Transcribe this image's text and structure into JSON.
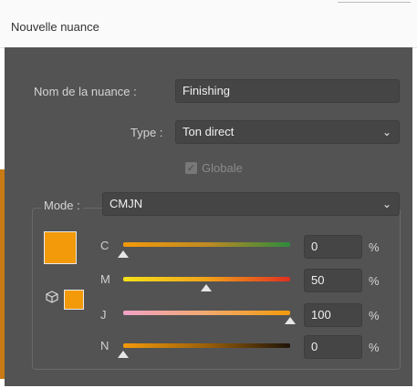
{
  "dialog": {
    "title": "Nouvelle nuance"
  },
  "form": {
    "name_label": "Nom de la nuance :",
    "name_value": "Finishing",
    "type_label": "Type :",
    "type_value": "Ton direct",
    "global_label": "Globale",
    "global_checked": true
  },
  "mode": {
    "label": "Mode :",
    "value": "CMJN"
  },
  "swatch": {
    "color": "#f39a0a"
  },
  "channels": [
    {
      "label": "C",
      "value": "0",
      "unit": "%",
      "level": 0
    },
    {
      "label": "M",
      "value": "50",
      "unit": "%",
      "level": 0.5
    },
    {
      "label": "J",
      "value": "100",
      "unit": "%",
      "level": 1
    },
    {
      "label": "N",
      "value": "0",
      "unit": "%",
      "level": 0
    }
  ],
  "icons": {
    "dropdown": "chevron-down-icon",
    "out_of_gamut": "cube-icon",
    "checkbox": "check-icon"
  }
}
